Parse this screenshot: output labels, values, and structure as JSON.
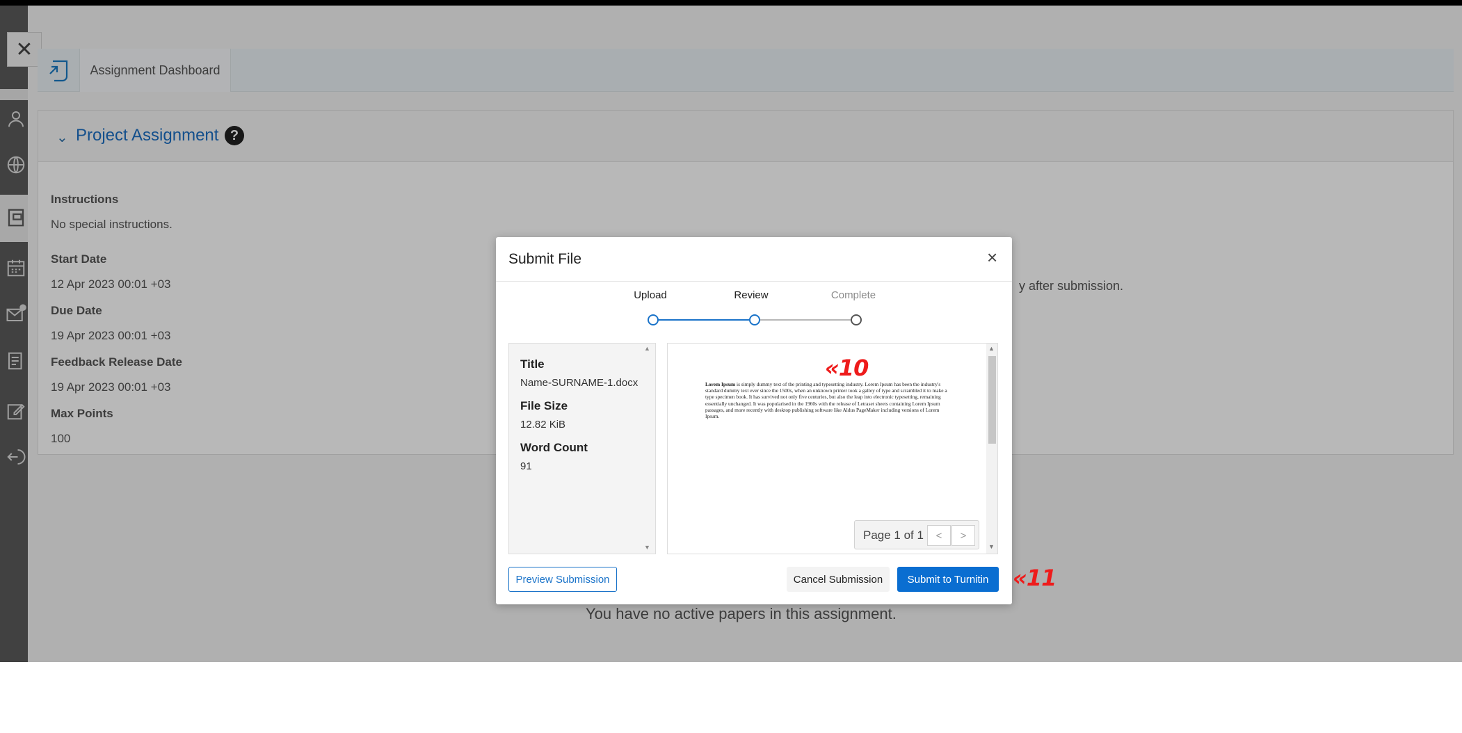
{
  "header": {
    "close_symbol": "✕",
    "dashboard_tab": "Assignment Dashboard"
  },
  "assignment": {
    "title": "Project Assignment",
    "help_symbol": "?",
    "fields": [
      {
        "label": "Instructions",
        "value": "No special instructions."
      },
      {
        "label": "Start Date",
        "value": "12 Apr 2023 00:01 +03"
      },
      {
        "label": "Due Date",
        "value": "19 Apr 2023 00:01 +03"
      },
      {
        "label": "Feedback Release Date",
        "value": "19 Apr 2023 00:01 +03"
      },
      {
        "label": "Max Points",
        "value": "100"
      }
    ],
    "notice_fragment": "y after submission.",
    "no_papers": "You have no active papers in this assignment."
  },
  "sidebar": {
    "icons": [
      "user-icon",
      "globe-icon",
      "assignment-icon",
      "calendar-icon",
      "mail-icon",
      "document-icon",
      "edit-icon",
      "logout-icon"
    ]
  },
  "modal": {
    "title": "Submit File",
    "close_symbol": "×",
    "steps": [
      {
        "label": "Upload",
        "state": "done"
      },
      {
        "label": "Review",
        "state": "current"
      },
      {
        "label": "Complete",
        "state": "pending"
      }
    ],
    "meta": {
      "title_label": "Title",
      "title_value": "Name-SURNAME-1.docx",
      "size_label": "File Size",
      "size_value": "12.82 KiB",
      "words_label": "Word Count",
      "words_value": "91"
    },
    "preview": {
      "lead": "Lorem Ipsum",
      "body": " is simply dummy text of the printing and typesetting industry. Lorem Ipsum has been the industry's standard dummy text ever since the 1500s, when an unknown printer took a galley of type and scrambled it to make a type specimen book. It has survived not only five centuries, but also the leap into electronic typesetting, remaining essentially unchanged. It was popularised in the 1960s with the release of Letraset sheets containing Lorem Ipsum passages, and more recently with desktop publishing software like Aldus PageMaker including versions of Lorem Ipsum.",
      "page_label": "Page 1 of 1",
      "prev": "<",
      "next": ">"
    },
    "buttons": {
      "preview": "Preview Submission",
      "cancel": "Cancel Submission",
      "submit": "Submit to Turnitin"
    }
  },
  "callouts": {
    "c10": "«10",
    "c11": "«11"
  },
  "colors": {
    "accent": "#0a6ed1",
    "callout": "#ee1b1b",
    "step_active": "#1a73c9"
  }
}
